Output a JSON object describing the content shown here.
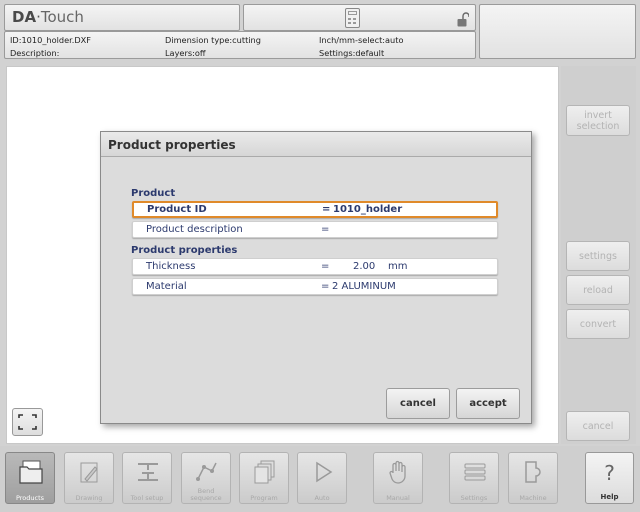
{
  "header": {
    "logo_da": "DA",
    "logo_dot": "·",
    "logo_touch": "Touch"
  },
  "info": {
    "id": "ID:1010_holder.DXF",
    "description": "Description:",
    "dimension_type": "Dimension type:cutting",
    "layers": "Layers:off",
    "inch_mm": "Inch/mm-select:auto",
    "settings": "Settings:default"
  },
  "side_buttons": {
    "invert_line1": "invert",
    "invert_line2": "selection",
    "settings": "settings",
    "reload": "reload",
    "convert": "convert",
    "cancel": "cancel"
  },
  "dialog": {
    "title": "Product properties",
    "section_product": "Product",
    "section_properties": "Product properties",
    "rows": [
      {
        "label": "Product ID",
        "eq": "=",
        "value": "1010_holder"
      },
      {
        "label": "Product description",
        "eq": "=",
        "value": ""
      },
      {
        "label": "Thickness",
        "eq": "=",
        "value": "2.00",
        "unit": "mm"
      },
      {
        "label": "Material",
        "eq": "=",
        "value": "2 ALUMINUM"
      }
    ],
    "cancel_label": "cancel",
    "accept_label": "accept"
  },
  "nav": [
    {
      "label": "Products",
      "icon": "folder-icon"
    },
    {
      "label": "Drawing",
      "icon": "pencil-icon"
    },
    {
      "label": "Tool setup",
      "icon": "tool-setup-icon"
    },
    {
      "label_line1": "Bend",
      "label_line2": "sequence",
      "icon": "bend-sequence-icon"
    },
    {
      "label": "Program",
      "icon": "program-icon"
    },
    {
      "label": "Auto",
      "icon": "play-icon"
    },
    {
      "label": "Manual",
      "icon": "hand-icon"
    },
    {
      "label": "Settings",
      "icon": "settings-list-icon"
    },
    {
      "label": "Machine",
      "icon": "machine-icon"
    },
    {
      "label": "Help",
      "icon": "help-icon",
      "glyph": "?"
    }
  ],
  "colors": {
    "accent_highlight": "#e08a2a",
    "label_blue": "#2c3a6e",
    "disabled_text": "#b3b3b3"
  }
}
